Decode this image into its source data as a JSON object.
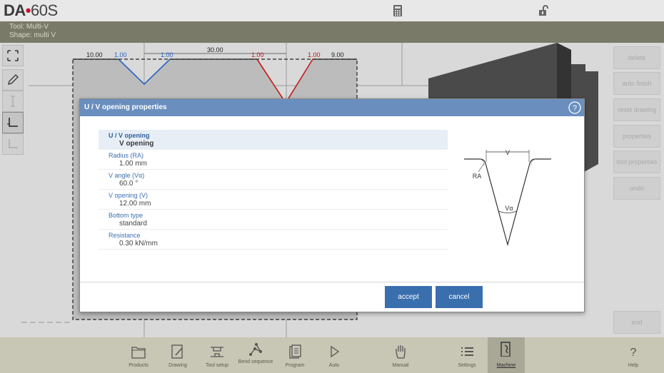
{
  "header": {
    "logo_brand": "DA",
    "logo_dot": "•",
    "logo_model": "60S",
    "icons": [
      "calculator-icon",
      "unlock-icon"
    ]
  },
  "info": {
    "tool": "Tool: Multi-V",
    "shape": "Shape: multi V"
  },
  "drawing": {
    "dims": {
      "d1": "10.00",
      "d2": "1.00",
      "d3": "1.00",
      "d4": "30.00",
      "d5": "1.00",
      "d6": "1.00",
      "d7": "9.00"
    },
    "colors": {
      "blue": "#2b63c0",
      "red": "#c41a1a",
      "tool_fill": "#bcbcbc"
    }
  },
  "left_tools": [
    "select-area-icon",
    "pencil-icon",
    "dimension-icon",
    "corner-icon",
    "corner-alt-icon"
  ],
  "right_buttons": {
    "delete": "delete",
    "auto_finish": "auto finish",
    "reset_drawing": "reset drawing",
    "properties": "properties",
    "tool_properties": "tool properties",
    "undo": "undo",
    "end": "end"
  },
  "dialog": {
    "title": "U / V opening properties",
    "properties": [
      {
        "label": "U / V opening",
        "value": "V opening"
      },
      {
        "label": "Radius (RA)",
        "value": "1.00 mm"
      },
      {
        "label": "V angle (Vα)",
        "value": "60.0 °"
      },
      {
        "label": "V opening (V)",
        "value": "12.00 mm"
      },
      {
        "label": "Bottom type",
        "value": "standard"
      },
      {
        "label": "Resistance",
        "value": "0.30 kN/mm"
      }
    ],
    "diagram_labels": {
      "v": "V",
      "ra": "RA",
      "valpha": "Vα"
    },
    "accept": "accept",
    "cancel": "cancel",
    "accent": "#3a6fae",
    "title_bg": "#6a8fbf"
  },
  "nav": {
    "products": "Products",
    "drawing": "Drawing",
    "tool_setup": "Tool setup",
    "bend_sequence": "Bend sequence",
    "program": "Program",
    "auto": "Auto",
    "manual": "Manual",
    "settings": "Settings",
    "machine": "Machine",
    "help": "Help"
  }
}
